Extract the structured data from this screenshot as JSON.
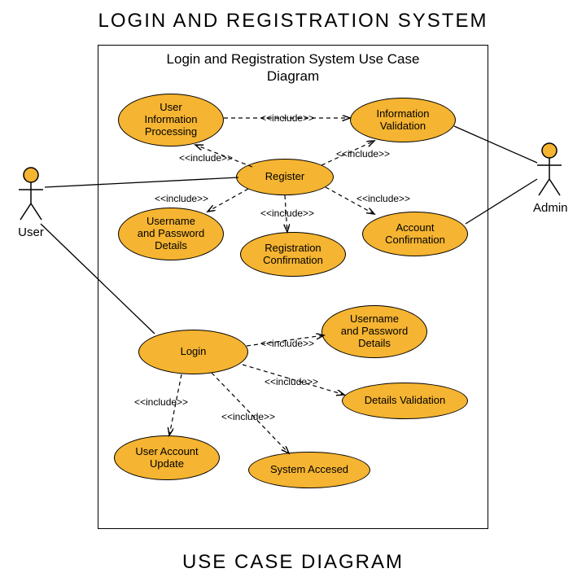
{
  "title_top": "LOGIN AND REGISTRATION SYSTEM",
  "title_bottom": "USE CASE DIAGRAM",
  "system_label": "Login and Registration System Use Case Diagram",
  "actors": {
    "user": "User",
    "admin": "Admin"
  },
  "usecases": {
    "uip": "User\nInformation\nProcessing",
    "iv": "Information\nValidation",
    "reg": "Register",
    "upd1": "Username\nand Password\nDetails",
    "rc": "Registration\nConfirmation",
    "ac": "Account\nConfirmation",
    "login": "Login",
    "upd2": "Username\nand Password\nDetails",
    "dv": "Details Validation",
    "uau": "User Account\nUpdate",
    "sa": "System Accesed"
  },
  "stereotypes": {
    "inc1": "<<include>>",
    "inc2": "<<include>>",
    "inc3": "<<include>>",
    "inc4": "<<include>>",
    "inc5": "<<include>>",
    "inc6": "<<include>>",
    "inc7": "<<include>>",
    "inc8": "<<include>>",
    "inc9": "<<include>>",
    "inc10": "<<include>>"
  },
  "chart_data": {
    "type": "uml-use-case",
    "title": "Login and Registration System Use Case Diagram",
    "actors": [
      "User",
      "Admin"
    ],
    "system": "Login and Registration System",
    "use_cases": [
      "User Information Processing",
      "Information Validation",
      "Register",
      "Username and Password Details",
      "Registration Confirmation",
      "Account Confirmation",
      "Login",
      "Username and Password Details",
      "Details Validation",
      "User Account Update",
      "System Accesed"
    ],
    "associations": [
      {
        "actor": "User",
        "use_case": "Register"
      },
      {
        "actor": "User",
        "use_case": "Login"
      },
      {
        "actor": "Admin",
        "use_case": "Information Validation"
      },
      {
        "actor": "Admin",
        "use_case": "Account Confirmation"
      }
    ],
    "includes": [
      {
        "from": "User Information Processing",
        "to": "Information Validation"
      },
      {
        "from": "Register",
        "to": "User Information Processing"
      },
      {
        "from": "Register",
        "to": "Information Validation"
      },
      {
        "from": "Register",
        "to": "Username and Password Details"
      },
      {
        "from": "Register",
        "to": "Registration Confirmation"
      },
      {
        "from": "Register",
        "to": "Account Confirmation"
      },
      {
        "from": "Login",
        "to": "Username and Password Details"
      },
      {
        "from": "Login",
        "to": "Details Validation"
      },
      {
        "from": "Login",
        "to": "User Account Update"
      },
      {
        "from": "Login",
        "to": "System Accesed"
      }
    ]
  }
}
